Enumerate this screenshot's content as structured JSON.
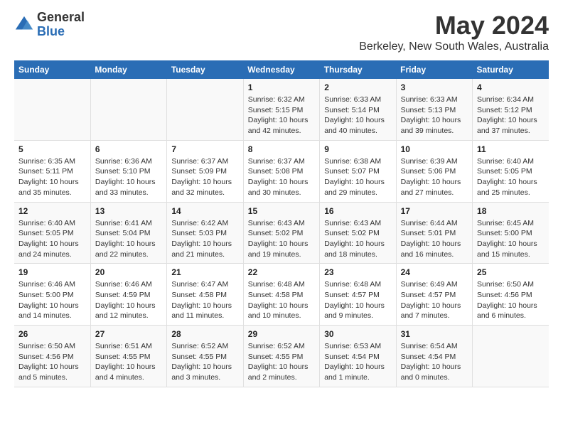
{
  "logo": {
    "general": "General",
    "blue": "Blue"
  },
  "title": "May 2024",
  "subtitle": "Berkeley, New South Wales, Australia",
  "days_of_week": [
    "Sunday",
    "Monday",
    "Tuesday",
    "Wednesday",
    "Thursday",
    "Friday",
    "Saturday"
  ],
  "weeks": [
    [
      {
        "day": "",
        "info": ""
      },
      {
        "day": "",
        "info": ""
      },
      {
        "day": "",
        "info": ""
      },
      {
        "day": "1",
        "info": "Sunrise: 6:32 AM\nSunset: 5:15 PM\nDaylight: 10 hours and 42 minutes."
      },
      {
        "day": "2",
        "info": "Sunrise: 6:33 AM\nSunset: 5:14 PM\nDaylight: 10 hours and 40 minutes."
      },
      {
        "day": "3",
        "info": "Sunrise: 6:33 AM\nSunset: 5:13 PM\nDaylight: 10 hours and 39 minutes."
      },
      {
        "day": "4",
        "info": "Sunrise: 6:34 AM\nSunset: 5:12 PM\nDaylight: 10 hours and 37 minutes."
      }
    ],
    [
      {
        "day": "5",
        "info": "Sunrise: 6:35 AM\nSunset: 5:11 PM\nDaylight: 10 hours and 35 minutes."
      },
      {
        "day": "6",
        "info": "Sunrise: 6:36 AM\nSunset: 5:10 PM\nDaylight: 10 hours and 33 minutes."
      },
      {
        "day": "7",
        "info": "Sunrise: 6:37 AM\nSunset: 5:09 PM\nDaylight: 10 hours and 32 minutes."
      },
      {
        "day": "8",
        "info": "Sunrise: 6:37 AM\nSunset: 5:08 PM\nDaylight: 10 hours and 30 minutes."
      },
      {
        "day": "9",
        "info": "Sunrise: 6:38 AM\nSunset: 5:07 PM\nDaylight: 10 hours and 29 minutes."
      },
      {
        "day": "10",
        "info": "Sunrise: 6:39 AM\nSunset: 5:06 PM\nDaylight: 10 hours and 27 minutes."
      },
      {
        "day": "11",
        "info": "Sunrise: 6:40 AM\nSunset: 5:05 PM\nDaylight: 10 hours and 25 minutes."
      }
    ],
    [
      {
        "day": "12",
        "info": "Sunrise: 6:40 AM\nSunset: 5:05 PM\nDaylight: 10 hours and 24 minutes."
      },
      {
        "day": "13",
        "info": "Sunrise: 6:41 AM\nSunset: 5:04 PM\nDaylight: 10 hours and 22 minutes."
      },
      {
        "day": "14",
        "info": "Sunrise: 6:42 AM\nSunset: 5:03 PM\nDaylight: 10 hours and 21 minutes."
      },
      {
        "day": "15",
        "info": "Sunrise: 6:43 AM\nSunset: 5:02 PM\nDaylight: 10 hours and 19 minutes."
      },
      {
        "day": "16",
        "info": "Sunrise: 6:43 AM\nSunset: 5:02 PM\nDaylight: 10 hours and 18 minutes."
      },
      {
        "day": "17",
        "info": "Sunrise: 6:44 AM\nSunset: 5:01 PM\nDaylight: 10 hours and 16 minutes."
      },
      {
        "day": "18",
        "info": "Sunrise: 6:45 AM\nSunset: 5:00 PM\nDaylight: 10 hours and 15 minutes."
      }
    ],
    [
      {
        "day": "19",
        "info": "Sunrise: 6:46 AM\nSunset: 5:00 PM\nDaylight: 10 hours and 14 minutes."
      },
      {
        "day": "20",
        "info": "Sunrise: 6:46 AM\nSunset: 4:59 PM\nDaylight: 10 hours and 12 minutes."
      },
      {
        "day": "21",
        "info": "Sunrise: 6:47 AM\nSunset: 4:58 PM\nDaylight: 10 hours and 11 minutes."
      },
      {
        "day": "22",
        "info": "Sunrise: 6:48 AM\nSunset: 4:58 PM\nDaylight: 10 hours and 10 minutes."
      },
      {
        "day": "23",
        "info": "Sunrise: 6:48 AM\nSunset: 4:57 PM\nDaylight: 10 hours and 9 minutes."
      },
      {
        "day": "24",
        "info": "Sunrise: 6:49 AM\nSunset: 4:57 PM\nDaylight: 10 hours and 7 minutes."
      },
      {
        "day": "25",
        "info": "Sunrise: 6:50 AM\nSunset: 4:56 PM\nDaylight: 10 hours and 6 minutes."
      }
    ],
    [
      {
        "day": "26",
        "info": "Sunrise: 6:50 AM\nSunset: 4:56 PM\nDaylight: 10 hours and 5 minutes."
      },
      {
        "day": "27",
        "info": "Sunrise: 6:51 AM\nSunset: 4:55 PM\nDaylight: 10 hours and 4 minutes."
      },
      {
        "day": "28",
        "info": "Sunrise: 6:52 AM\nSunset: 4:55 PM\nDaylight: 10 hours and 3 minutes."
      },
      {
        "day": "29",
        "info": "Sunrise: 6:52 AM\nSunset: 4:55 PM\nDaylight: 10 hours and 2 minutes."
      },
      {
        "day": "30",
        "info": "Sunrise: 6:53 AM\nSunset: 4:54 PM\nDaylight: 10 hours and 1 minute."
      },
      {
        "day": "31",
        "info": "Sunrise: 6:54 AM\nSunset: 4:54 PM\nDaylight: 10 hours and 0 minutes."
      },
      {
        "day": "",
        "info": ""
      }
    ]
  ]
}
